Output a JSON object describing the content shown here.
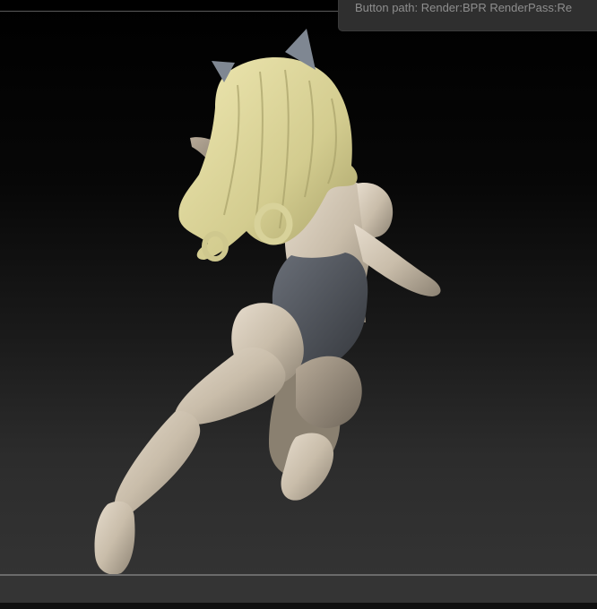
{
  "tooltip": {
    "text": "Button path: Render:BPR RenderPass:Re"
  },
  "colors": {
    "background_top": "#000000",
    "background_bottom": "#353535",
    "skin": "#cfc4b4",
    "hair": "#d8d29a",
    "bodysuit": "#4b4f56",
    "ears": "#7f8792",
    "floor_line": "#6b6b6b"
  },
  "icons": {
    "model": "sculpted-figure-render"
  }
}
